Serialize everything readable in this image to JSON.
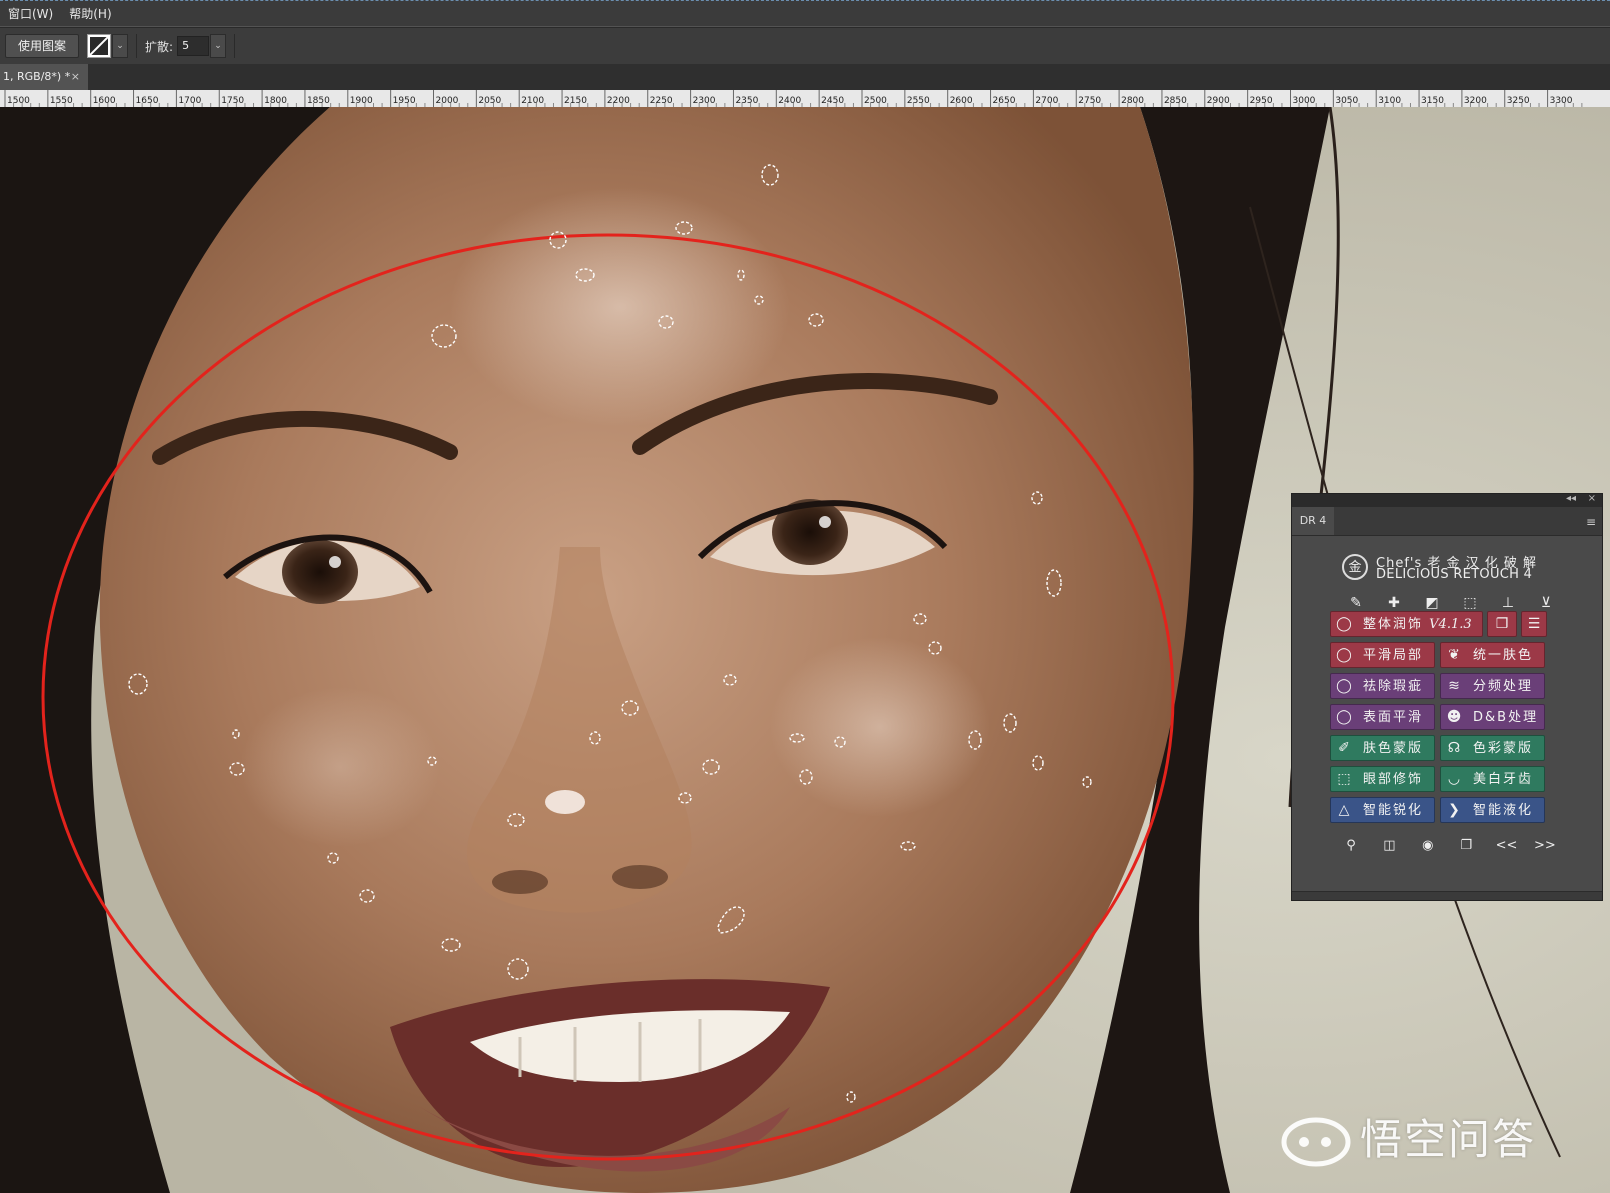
{
  "menu": [
    "窗口(W)",
    "帮助(H)"
  ],
  "options": {
    "use_pattern_label": "使用图案",
    "spread_label": "扩散:",
    "spread_value": "5",
    "dropdown_glyph": "⌄"
  },
  "document_tab": {
    "title": "1, RGB/8*) *",
    "close": "×"
  },
  "ruler_ticks": [
    "1500",
    "1550",
    "1600",
    "1650",
    "1700",
    "1750",
    "1800",
    "1850",
    "1900",
    "1950",
    "2000",
    "2050",
    "2100",
    "2150",
    "2200",
    "2250",
    "2300",
    "2350",
    "2400",
    "2450",
    "2500",
    "2550",
    "2600",
    "2650",
    "2700",
    "2750",
    "2800",
    "2850",
    "2900",
    "2950",
    "3000",
    "3050",
    "3100",
    "3150",
    "3200",
    "3250",
    "3300"
  ],
  "panel": {
    "title": "DR 4",
    "collapse_glyph": "◂◂",
    "close_glyph": "×",
    "menu_glyph": "≡",
    "brand_line1": "Chef's 老 金 汉 化 破 解",
    "brand_line2": "DELICIOUS RETOUCH 4",
    "logo_glyph": "金",
    "tool_icons": [
      "brush-mask-icon",
      "heal-icon",
      "bandage-icon",
      "select-icon",
      "stamp-icon",
      "clone-stamp-icon"
    ],
    "rows": [
      {
        "left": {
          "label": "整体润饰",
          "version": "V4.1.3",
          "icon": "lasso-icon",
          "color": "red"
        },
        "extra1_icon": "layers-icon",
        "extra2_icon": "sliders-icon"
      },
      {
        "left": {
          "label": "平滑局部",
          "icon": "lasso-icon",
          "color": "red"
        },
        "right": {
          "label": "统一肤色",
          "icon": "feather-icon",
          "color": "red"
        }
      },
      {
        "left": {
          "label": "祛除瑕疵",
          "icon": "lasso-icon",
          "color": "purple"
        },
        "right": {
          "label": "分频处理",
          "icon": "wave-icon",
          "color": "purple"
        }
      },
      {
        "left": {
          "label": "表面平滑",
          "icon": "lasso-icon",
          "color": "purple"
        },
        "right": {
          "label": "D&B处理",
          "icon": "face-icon",
          "color": "purple"
        }
      },
      {
        "left": {
          "label": "肤色蒙版",
          "icon": "eyedropper-icon",
          "color": "green"
        },
        "right": {
          "label": "色彩蒙版",
          "icon": "mask-icon",
          "color": "green"
        }
      },
      {
        "left": {
          "label": "眼部修饰",
          "icon": "marquee-icon",
          "color": "green"
        },
        "right": {
          "label": "美白牙齿",
          "icon": "lips-icon",
          "color": "green"
        }
      },
      {
        "left": {
          "label": "智能锐化",
          "icon": "sharpen-icon",
          "color": "blue"
        },
        "right": {
          "label": "智能液化",
          "icon": "liquify-icon",
          "color": "blue"
        }
      }
    ],
    "bottom_icons": [
      "zoom-icon",
      "compare-icon",
      "view-icon",
      "duplicate-icon"
    ],
    "prev_glyph": "<<",
    "next_glyph": ">>"
  },
  "watermark": {
    "text": "悟空问答"
  },
  "colors": {
    "selection_ellipse": "#e3231c",
    "panel_bg": "#4a4a4a",
    "red_btn": "#9c3947",
    "purple_btn": "#6a3f78",
    "green_btn": "#2f7a5f",
    "blue_btn": "#3a5488"
  }
}
